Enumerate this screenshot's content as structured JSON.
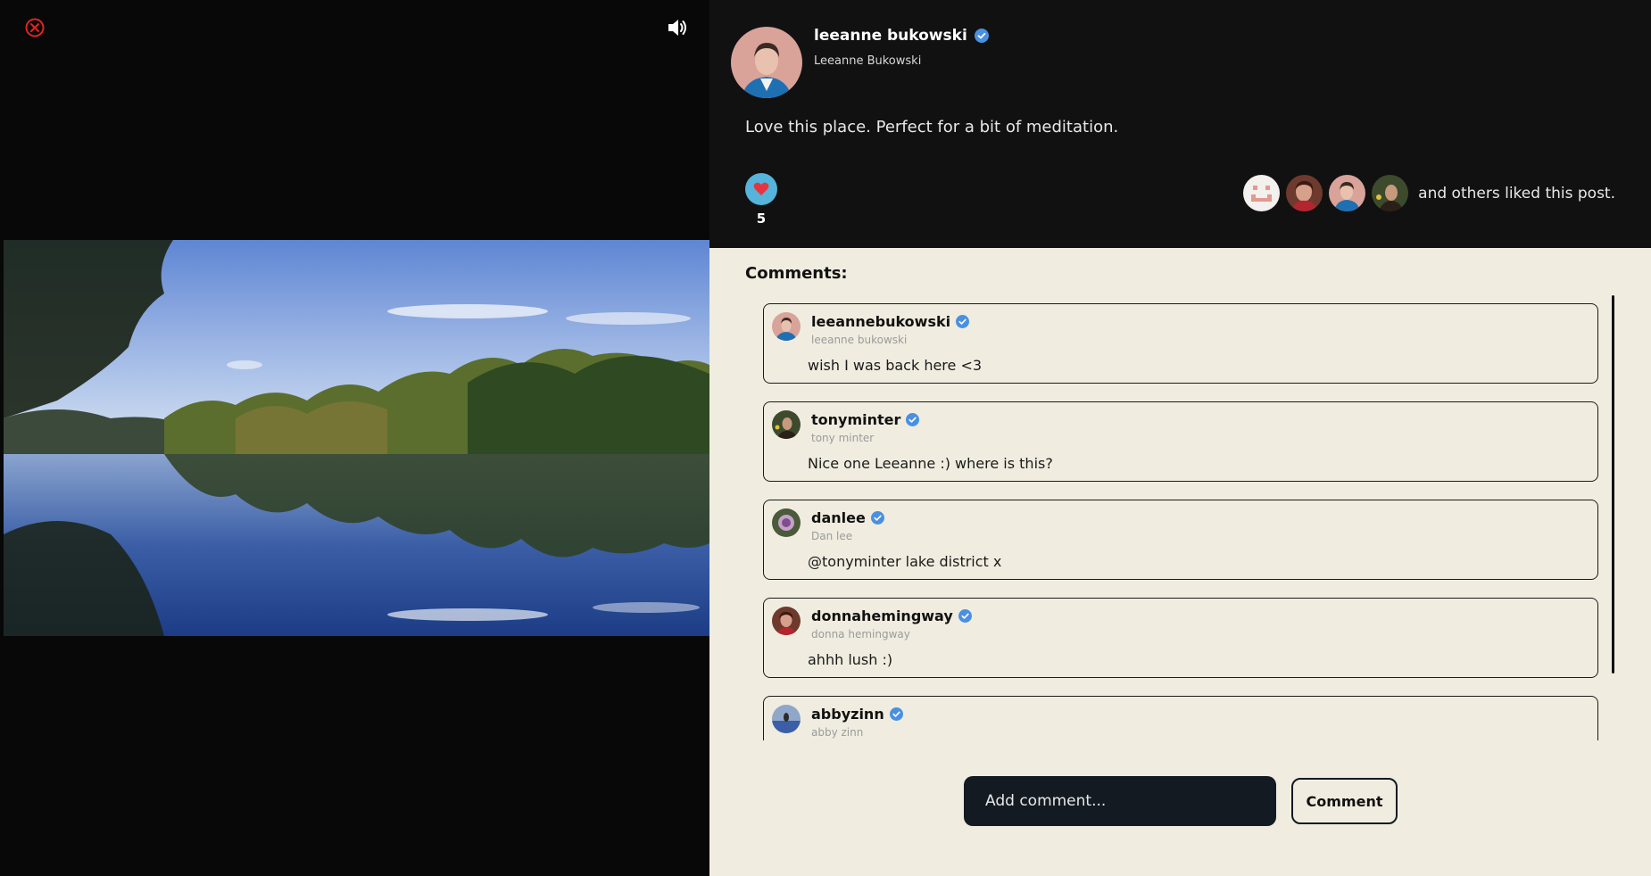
{
  "media": {
    "close_icon": "close-circle-icon",
    "sound_icon": "speaker-volume-icon"
  },
  "post": {
    "author_name": "leeanne bukowski",
    "author_handle": "Leeanne Bukowski",
    "caption": "Love this place. Perfect for a bit of meditation.",
    "like_count": "5",
    "likers_text": "and others liked this post.",
    "colors": {
      "like_button": "#56b3da",
      "heart": "#e8343e",
      "verified": "#4a90e2"
    }
  },
  "comments": {
    "title": "Comments:",
    "items": [
      {
        "username": "leeannebukowski",
        "display_name": "leeanne bukowski",
        "text": "wish I was back here <3"
      },
      {
        "username": "tonyminter",
        "display_name": "tony minter",
        "text": "Nice one Leeanne :) where is this?"
      },
      {
        "username": "danlee",
        "display_name": "Dan lee",
        "text": "@tonyminter lake district x"
      },
      {
        "username": "donnahemingway",
        "display_name": "donna hemingway",
        "text": "ahhh lush :)"
      },
      {
        "username": "abbyzinn",
        "display_name": "abby zinn",
        "text": ""
      }
    ]
  },
  "composer": {
    "placeholder": "Add comment...",
    "submit_label": "Comment"
  }
}
